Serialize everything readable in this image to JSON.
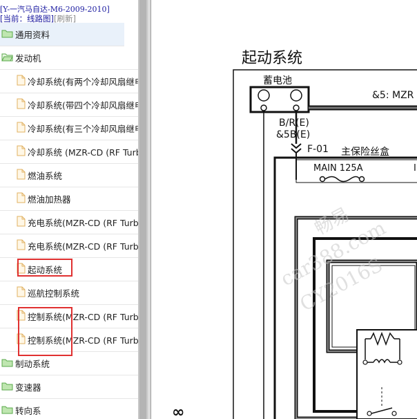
{
  "sidebar": {
    "vehicle": "[Y-一汽马自达-M6-2009-2010]",
    "current_prefix": "[当前：",
    "current_value": "线路图",
    "current_suffix": "]",
    "refresh_label": "[刷新]",
    "items": [
      {
        "label": "通用资料",
        "type": "folder-closed",
        "selected": true
      },
      {
        "label": "发动机",
        "type": "folder-open"
      },
      {
        "label": "冷却系统(有两个冷却风扇继电器)",
        "type": "file"
      },
      {
        "label": "冷却系统(带四个冷却风扇继电器)",
        "type": "file"
      },
      {
        "label": "冷却系统(有三个冷却风扇继电器)",
        "type": "file"
      },
      {
        "label": "冷却系统 (MZR-CD (RF Turbo))",
        "type": "file"
      },
      {
        "label": "燃油系统",
        "type": "file"
      },
      {
        "label": "燃油加热器",
        "type": "file"
      },
      {
        "label": "充电系统(MZR-CD (RF Turbo))",
        "type": "file"
      },
      {
        "label": "充电系统(MZR-CD (RF Turbo))",
        "type": "file"
      },
      {
        "label": "起动系统",
        "type": "file"
      },
      {
        "label": "巡航控制系统",
        "type": "file"
      },
      {
        "label": "控制系统(MZR-CD (RF Turbo))",
        "type": "file"
      },
      {
        "label": "控制系统(MZR-CD (RF Turbo))",
        "type": "file"
      },
      {
        "label": "制动系统",
        "type": "folder-closed"
      },
      {
        "label": "变速器",
        "type": "folder-closed"
      },
      {
        "label": "转向系",
        "type": "folder-closed"
      }
    ]
  },
  "diagram": {
    "title": "起动系统",
    "battery_label": "蓄电池",
    "minus": "⊖",
    "plus": "⊕",
    "wire_label": "&5: MZR",
    "wire_color": "B/R(E)",
    "wire_code": "&5B(E)",
    "connector": "F-01",
    "fuse_box": "主保险丝盒",
    "fuse_name": "MAIN 125A",
    "fuse_name2": "I",
    "bottom_symbol": "∞"
  },
  "watermark": {
    "line1": "畅易",
    "line2": "car388.com",
    "line3": "CY2016S"
  },
  "colors": {
    "link": "#1a1aa0",
    "highlight": "#e03030",
    "folder": "#7fc56f",
    "file": "#f5d59a"
  }
}
